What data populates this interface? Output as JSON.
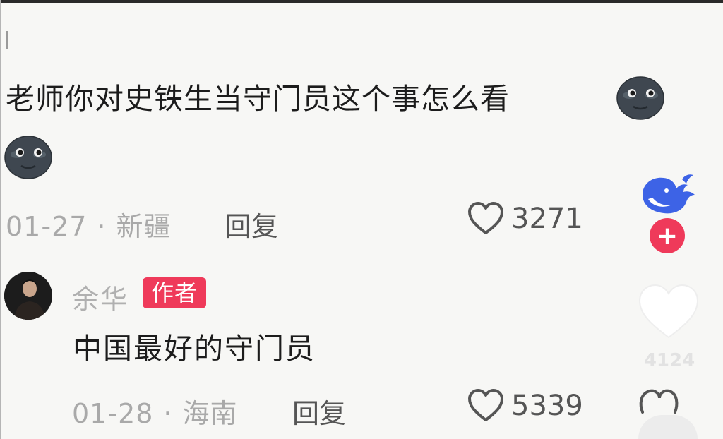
{
  "comment": {
    "text": "老师你对史铁生当守门员这个事怎么看",
    "date": "01-27",
    "separator": "·",
    "location": "新疆",
    "reply_label": "回复",
    "likes": "3271",
    "emoji_icon": "dark-moon-face-icon"
  },
  "author_reply": {
    "name": "余华",
    "badge": "作者",
    "text": "中国最好的守门员",
    "date": "01-28",
    "separator": "·",
    "location": "海南",
    "reply_label": "回复",
    "likes": "5339"
  },
  "side_rail": {
    "logo_icon": "whale-logo-icon",
    "follow_symbol": "+",
    "like_count": "4124",
    "accent_color": "#ef3a5a",
    "logo_color": "#3d63e6"
  }
}
